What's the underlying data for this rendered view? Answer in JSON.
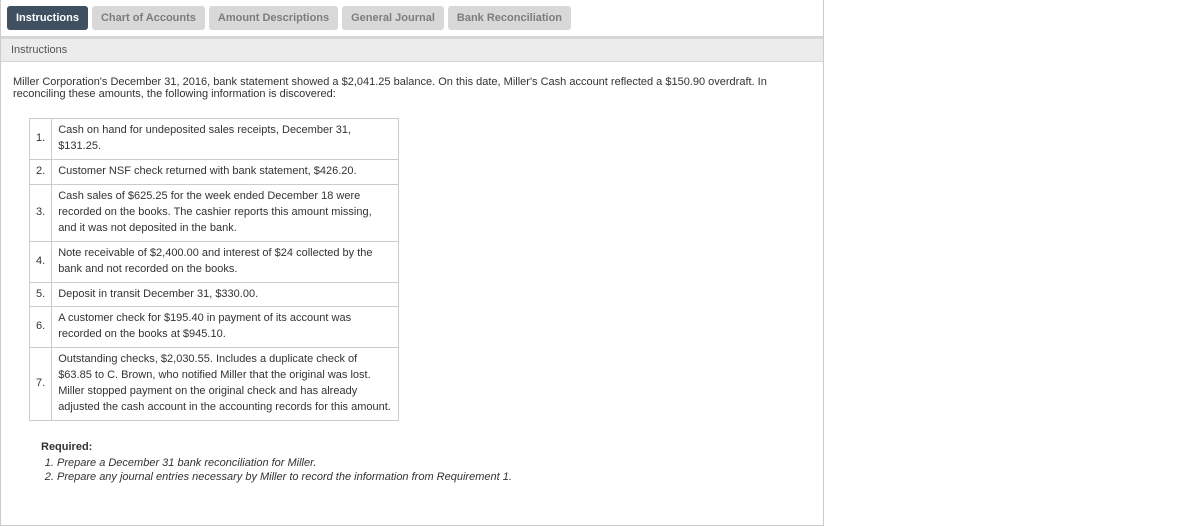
{
  "tabs": [
    {
      "label": "Instructions",
      "active": true
    },
    {
      "label": "Chart of Accounts",
      "active": false
    },
    {
      "label": "Amount Descriptions",
      "active": false
    },
    {
      "label": "General Journal",
      "active": false
    },
    {
      "label": "Bank Reconciliation",
      "active": false
    }
  ],
  "section_header": "Instructions",
  "intro": "Miller Corporation's December 31, 2016, bank statement showed a $2,041.25 balance. On this date, Miller's Cash account reflected a $150.90 overdraft. In reconciling these amounts, the following information is discovered:",
  "items": [
    {
      "n": "1.",
      "text": "Cash on hand for undeposited sales receipts, December 31, $131.25."
    },
    {
      "n": "2.",
      "text": "Customer NSF check returned with bank statement, $426.20."
    },
    {
      "n": "3.",
      "text": "Cash sales of $625.25 for the week ended December 18 were recorded on the books. The cashier reports this amount missing, and it was not deposited in the bank."
    },
    {
      "n": "4.",
      "text": "Note receivable of $2,400.00 and interest of $24 collected by the bank and not recorded on the books."
    },
    {
      "n": "5.",
      "text": "Deposit in transit December 31, $330.00."
    },
    {
      "n": "6.",
      "text": "A customer check for $195.40 in payment of its account was recorded on the books at $945.10."
    },
    {
      "n": "7.",
      "text": "Outstanding checks, $2,030.55. Includes a duplicate check of $63.85 to C. Brown, who notified Miller that the original was lost. Miller stopped payment on the original check and has already adjusted the cash account in the accounting records for this amount."
    }
  ],
  "required_head": "Required:",
  "required": [
    "Prepare a December 31 bank reconciliation for Miller.",
    "Prepare any journal entries necessary by Miller to record the information from Requirement 1."
  ]
}
